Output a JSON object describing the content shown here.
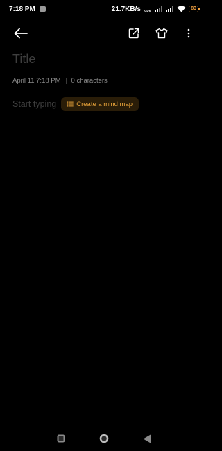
{
  "status_bar": {
    "time": "7:18 PM",
    "network_speed": "21.7KB/s",
    "vpn": "VPN",
    "battery": "83"
  },
  "toolbar": {
    "back_icon": "arrow-left-icon",
    "share_icon": "share-external-icon",
    "theme_icon": "tshirt-icon",
    "more_icon": "more-vertical-icon"
  },
  "note": {
    "title_placeholder": "Title",
    "date": "April 11 7:18 PM",
    "char_count": "0 characters",
    "body_placeholder": "Start typing",
    "mind_map_label": "Create a mind map"
  },
  "colors": {
    "background": "#000000",
    "accent": "#e6a23a",
    "accent_bg": "#2a1d08",
    "placeholder": "#3e3e3e",
    "meta_text": "#8a8a8a",
    "battery": "#f0a040"
  },
  "nav_bar": {
    "recents_icon": "square-recents-icon",
    "home_icon": "circle-home-icon",
    "back_icon": "triangle-back-icon"
  }
}
